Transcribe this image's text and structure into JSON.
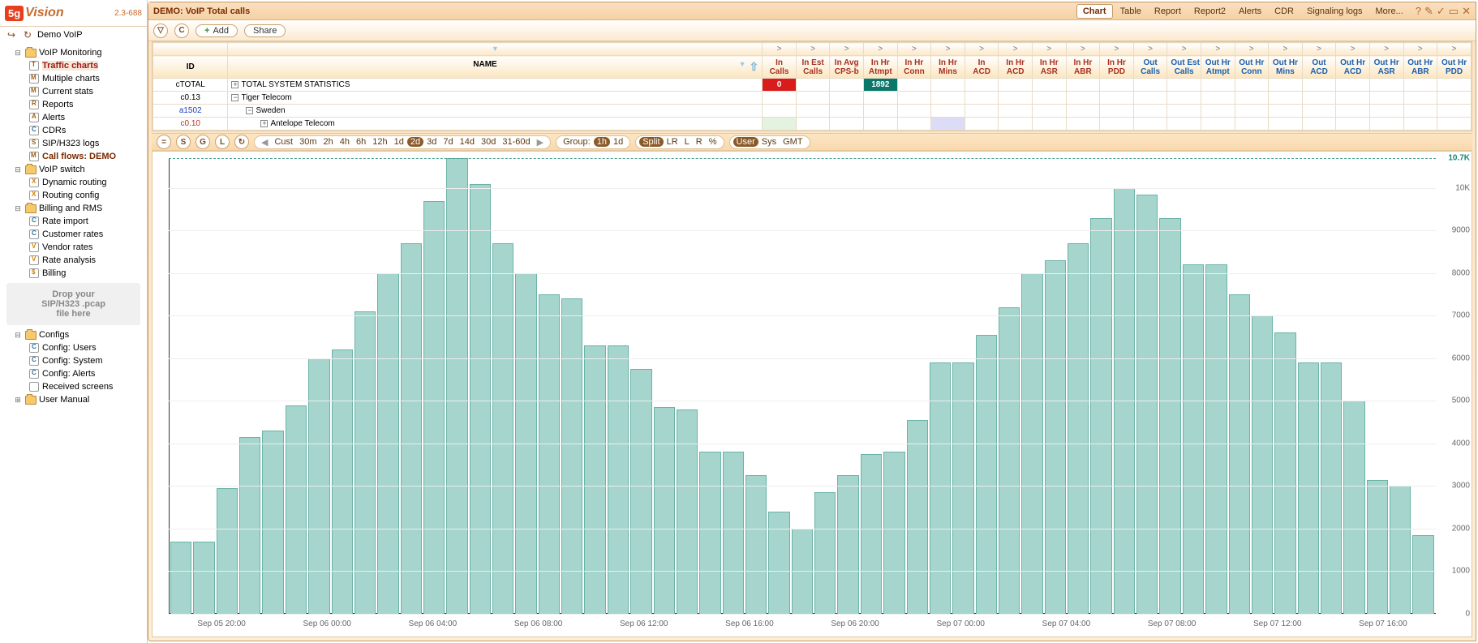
{
  "logo": {
    "mark": "5g",
    "text": "Vision",
    "version": "2.3-688"
  },
  "user_label": "Demo VoIP",
  "tree": [
    {
      "label": "VoIP Monitoring",
      "type": "folder",
      "open": true,
      "level": 0,
      "children": [
        {
          "label": "Traffic charts",
          "type": "page",
          "ico": "t",
          "selected": true
        },
        {
          "label": "Multiple charts",
          "type": "page",
          "ico": "m"
        },
        {
          "label": "Current stats",
          "type": "page",
          "ico": "m"
        },
        {
          "label": "Reports",
          "type": "page",
          "ico": "r"
        },
        {
          "label": "Alerts",
          "type": "page",
          "ico": "a"
        },
        {
          "label": "CDRs",
          "type": "page",
          "ico": "c"
        },
        {
          "label": "SIP/H323 logs",
          "type": "page",
          "ico": "s"
        },
        {
          "label": "Call flows: DEMO",
          "type": "page",
          "ico": "m",
          "bold": true
        }
      ]
    },
    {
      "label": "VoIP switch",
      "type": "folder",
      "open": true,
      "level": 0,
      "children": [
        {
          "label": "Dynamic routing",
          "type": "page",
          "ico": "x"
        },
        {
          "label": "Routing config",
          "type": "page",
          "ico": "x"
        }
      ]
    },
    {
      "label": "Billing and RMS",
      "type": "folder",
      "open": true,
      "level": 0,
      "children": [
        {
          "label": "Rate import",
          "type": "page",
          "ico": "c"
        },
        {
          "label": "Customer rates",
          "type": "page",
          "ico": "c"
        },
        {
          "label": "Vendor rates",
          "type": "page",
          "ico": "v"
        },
        {
          "label": "Rate analysis",
          "type": "page",
          "ico": "v"
        },
        {
          "label": "Billing",
          "type": "page",
          "ico": "b"
        }
      ]
    },
    {
      "label": "Configs",
      "type": "folder",
      "open": true,
      "level": 0,
      "gap": true,
      "children": [
        {
          "label": "Config: Users",
          "type": "page",
          "ico": "c"
        },
        {
          "label": "Config: System",
          "type": "page",
          "ico": "c"
        },
        {
          "label": "Config: Alerts",
          "type": "page",
          "ico": "c"
        },
        {
          "label": "Received screens",
          "type": "page",
          "ico": "u"
        }
      ]
    },
    {
      "label": "User Manual",
      "type": "folder",
      "open": false,
      "level": 0
    }
  ],
  "drop_zone": "Drop your\nSIP/H323 .pcap\nfile here",
  "title": "DEMO: VoIP Total calls",
  "tabs": [
    "Chart",
    "Table",
    "Report",
    "Report2",
    "Alerts",
    "CDR",
    "Signaling logs",
    "More..."
  ],
  "active_tab": "Chart",
  "toolbar": {
    "add": "Add",
    "share": "Share"
  },
  "grid": {
    "id_header": "ID",
    "name_header": "NAME",
    "cols": [
      {
        "t": "In",
        "b": "Calls",
        "cls": "in"
      },
      {
        "t": "In Est",
        "b": "Calls",
        "cls": "in"
      },
      {
        "t": "In Avg",
        "b": "CPS-b",
        "cls": "in"
      },
      {
        "t": "In Hr",
        "b": "Atmpt",
        "cls": "in"
      },
      {
        "t": "In Hr",
        "b": "Conn",
        "cls": "in"
      },
      {
        "t": "In Hr",
        "b": "Mins",
        "cls": "in"
      },
      {
        "t": "In",
        "b": "ACD",
        "cls": "in"
      },
      {
        "t": "In Hr",
        "b": "ACD",
        "cls": "in"
      },
      {
        "t": "In Hr",
        "b": "ASR",
        "cls": "in"
      },
      {
        "t": "In Hr",
        "b": "ABR",
        "cls": "in"
      },
      {
        "t": "In Hr",
        "b": "PDD",
        "cls": "in"
      },
      {
        "t": "Out",
        "b": "Calls",
        "cls": "out"
      },
      {
        "t": "Out Est",
        "b": "Calls",
        "cls": "out"
      },
      {
        "t": "Out Hr",
        "b": "Atmpt",
        "cls": "out"
      },
      {
        "t": "Out Hr",
        "b": "Conn",
        "cls": "out"
      },
      {
        "t": "Out Hr",
        "b": "Mins",
        "cls": "out"
      },
      {
        "t": "Out",
        "b": "ACD",
        "cls": "out"
      },
      {
        "t": "Out Hr",
        "b": "ACD",
        "cls": "out"
      },
      {
        "t": "Out Hr",
        "b": "ASR",
        "cls": "out"
      },
      {
        "t": "Out Hr",
        "b": "ABR",
        "cls": "out"
      },
      {
        "t": "Out Hr",
        "b": "PDD",
        "cls": "out"
      }
    ],
    "rows": [
      {
        "id": "cTOTAL",
        "name": "TOTAL SYSTEM STATISTICS",
        "exp": "+",
        "indent": 0,
        "cells": {
          "0": {
            "v": "0",
            "cls": "cell-red"
          },
          "3": {
            "v": "1892",
            "cls": "cell-teal"
          }
        }
      },
      {
        "id": "c0.13",
        "name": "Tiger Telecom",
        "exp": "−",
        "indent": 0,
        "cells": {}
      },
      {
        "id": "a1502",
        "name": "Sweden",
        "exp": "−",
        "indent": 1,
        "rowcls": "row-blue",
        "cells": {}
      },
      {
        "id": "c0.10",
        "name": "Antelope Telecom",
        "exp": "+",
        "indent": 2,
        "rowcls": "row-red",
        "cells": {
          "0": {
            "v": "",
            "cls": "cell-lg"
          },
          "5": {
            "v": "",
            "cls": "cell-lp"
          }
        }
      }
    ]
  },
  "chart_toolbar": {
    "left_btns": [
      "=",
      "S",
      "G",
      "L",
      "↻"
    ],
    "range_label": "Cust",
    "ranges": [
      "30m",
      "2h",
      "4h",
      "6h",
      "12h",
      "1d",
      "2d",
      "3d",
      "7d",
      "14d",
      "30d",
      "31-60d"
    ],
    "range_active": "2d",
    "group_label": "Group:",
    "groups": [
      "1h",
      "1d"
    ],
    "group_active": "1h",
    "split_label": "Split",
    "splits": [
      "LR",
      "L",
      "R",
      "%"
    ],
    "user_label": "User",
    "users": [
      "Sys",
      "GMT"
    ]
  },
  "chart_data": {
    "type": "bar",
    "title": "VoIP Total calls",
    "ylabel": "",
    "ylim": [
      0,
      10700
    ],
    "y_max_label": "10.7K",
    "y_ticks": [
      0,
      1000,
      2000,
      3000,
      4000,
      5000,
      6000,
      7000,
      8000,
      9000,
      10000
    ],
    "x_ticks": [
      "Sep 05 20:00",
      "Sep 06 00:00",
      "Sep 06 04:00",
      "Sep 06 08:00",
      "Sep 06 12:00",
      "Sep 06 16:00",
      "Sep 06 20:00",
      "Sep 07 00:00",
      "Sep 07 04:00",
      "Sep 07 08:00",
      "Sep 07 12:00",
      "Sep 07 16:00"
    ],
    "values": [
      1700,
      1700,
      2950,
      4150,
      4300,
      4900,
      6000,
      6200,
      7100,
      8000,
      8700,
      9700,
      10700,
      10100,
      8700,
      8000,
      7500,
      7400,
      6300,
      6300,
      5750,
      4850,
      4800,
      3800,
      3800,
      3250,
      2400,
      2000,
      2850,
      3250,
      3750,
      3800,
      4550,
      5900,
      5900,
      6550,
      7200,
      8000,
      8300,
      8700,
      9300,
      10000,
      9850,
      9300,
      8200,
      8200,
      7500,
      7000,
      6600,
      5900,
      5900,
      5000,
      3150,
      3000,
      1850
    ]
  }
}
